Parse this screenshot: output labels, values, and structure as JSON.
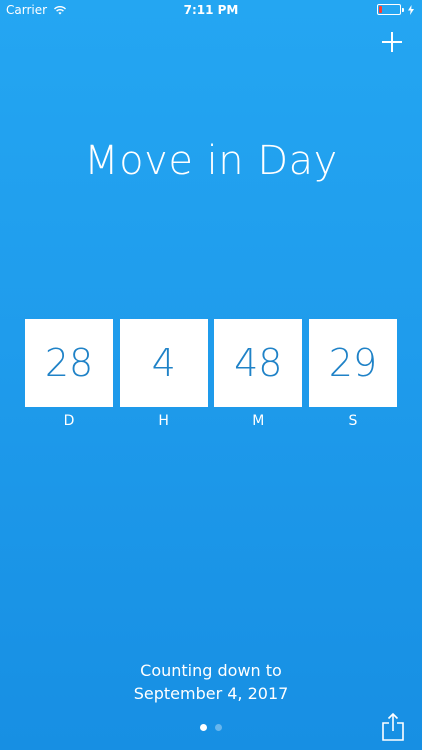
{
  "status_bar": {
    "carrier": "Carrier",
    "time": "7:11 PM",
    "battery_level": 0.15,
    "battery_color": "#ff3b30",
    "charging_icon": "bolt-icon",
    "wifi_icon": "wifi-icon"
  },
  "toolbar": {
    "add_icon": "plus-icon",
    "share_icon": "share-icon"
  },
  "event": {
    "title": "Move in Day"
  },
  "countdown": {
    "days": {
      "value": "28",
      "label": "D"
    },
    "hours": {
      "value": "4",
      "label": "H"
    },
    "minutes": {
      "value": "48",
      "label": "M"
    },
    "seconds": {
      "value": "29",
      "label": "S"
    }
  },
  "footer": {
    "counting_label": "Counting down to",
    "target_date": "September 4, 2017"
  },
  "pager": {
    "count": 2,
    "active_index": 0
  },
  "colors": {
    "background": "#1f9cec",
    "box_text": "#1f82c7",
    "box_bg": "#ffffff"
  }
}
